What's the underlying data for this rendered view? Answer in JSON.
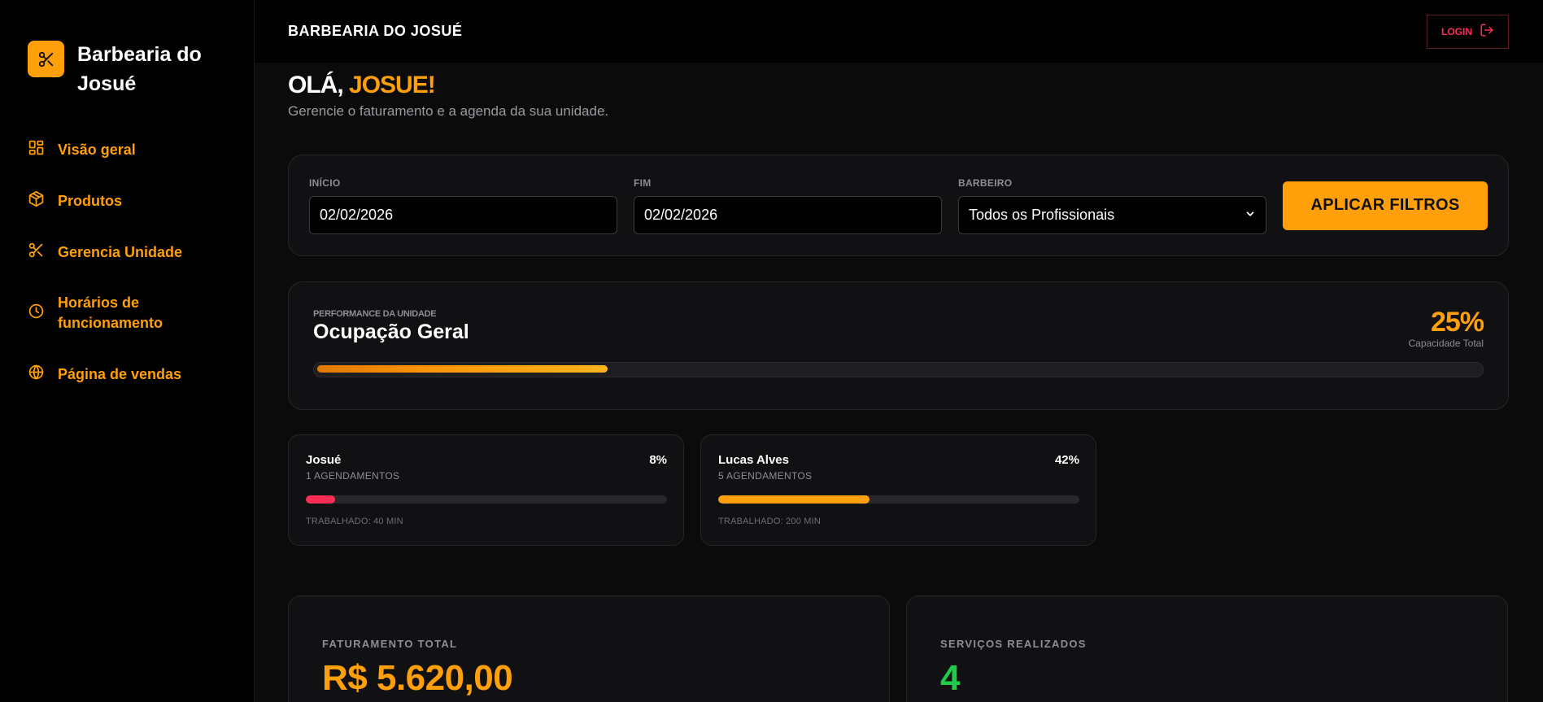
{
  "sidebar": {
    "brand": {
      "name": "Barbearia do Josué",
      "icon": "scissors-icon"
    },
    "items": [
      {
        "label": "Visão geral",
        "icon": "grid-icon"
      },
      {
        "label": "Produtos",
        "icon": "package-icon"
      },
      {
        "label": "Gerencia Unidade",
        "icon": "scissors-icon"
      },
      {
        "label": "Horários de funcionamento",
        "icon": "clock-icon"
      },
      {
        "label": "Página de vendas",
        "icon": "globe-icon"
      }
    ]
  },
  "topbar": {
    "title": "BARBEARIA DO JOSUÉ",
    "login_label": "LOGIN"
  },
  "greeting": {
    "prefix": "OLÁ,",
    "name": "JOSUE!",
    "subtitle": "Gerencie o faturamento e a agenda da sua unidade."
  },
  "filters": {
    "start": {
      "label": "INÍCIO",
      "value": "02/02/2026"
    },
    "end": {
      "label": "FIM",
      "value": "02/02/2026"
    },
    "barber": {
      "label": "BARBEIRO",
      "value": "Todos os Profissionais"
    },
    "apply_label": "APLICAR FILTROS"
  },
  "performance": {
    "kicker": "PERFORMANCE DA UNIDADE",
    "title": "Ocupação Geral",
    "percent_label": "25%",
    "percent_value": 25,
    "caption": "Capacidade Total"
  },
  "barbers": [
    {
      "name": "Josué",
      "percent_label": "8%",
      "percent_value": 8,
      "appointments": "1 AGENDAMENTOS",
      "worked": "TRABALHADO: 40 MIN",
      "color": "#ff2d55"
    },
    {
      "name": "Lucas Alves",
      "percent_label": "42%",
      "percent_value": 42,
      "appointments": "5 AGENDAMENTOS",
      "worked": "TRABALHADO: 200 MIN",
      "color": "#ff9f0a"
    }
  ],
  "stats": [
    {
      "label": "FATURAMENTO TOTAL",
      "value": "R$ 5.620,00",
      "color": "#ff9f0a"
    },
    {
      "label": "SERVIÇOS REALIZADOS",
      "value": "4",
      "color": "#1fcc4a"
    }
  ],
  "colors": {
    "accent": "#ff9f0a",
    "danger": "#ff2d55",
    "success": "#1fcc4a"
  }
}
